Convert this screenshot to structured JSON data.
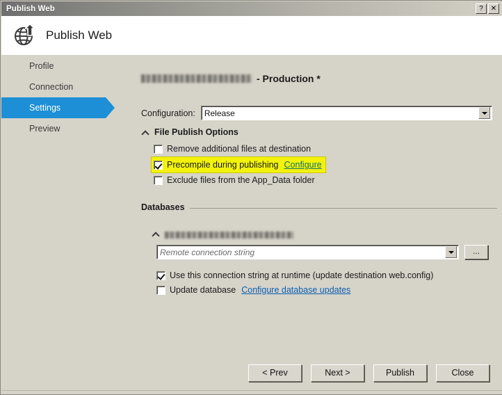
{
  "window": {
    "title": "Publish Web",
    "help_button": "?",
    "close_button": "✕"
  },
  "header": {
    "icon": "globe-publish-icon",
    "title": "Publish Web"
  },
  "sidebar": {
    "items": [
      {
        "label": "Profile",
        "selected": false
      },
      {
        "label": "Connection",
        "selected": false
      },
      {
        "label": "Settings",
        "selected": true
      },
      {
        "label": "Preview",
        "selected": false
      }
    ]
  },
  "main": {
    "profile_title_redacted": "",
    "profile_title_suffix": "- Production *",
    "configuration": {
      "label": "Configuration:",
      "value": "Release"
    },
    "file_publish_options": {
      "section_label": "File Publish Options",
      "expanded": true,
      "options": [
        {
          "label": "Remove additional files at destination",
          "checked": false,
          "highlighted": false,
          "link": null
        },
        {
          "label": "Precompile during publishing",
          "checked": true,
          "highlighted": true,
          "link": "Configure"
        },
        {
          "label": "Exclude files from the App_Data folder",
          "checked": false,
          "highlighted": false,
          "link": null
        }
      ]
    },
    "databases": {
      "section_label": "Databases",
      "entry_name_redacted": "",
      "entry_expanded": true,
      "connection_string_placeholder": "Remote connection string",
      "connection_string_value": "",
      "browse_button": "...",
      "options": [
        {
          "label": "Use this connection string at runtime (update destination web.config)",
          "checked": true,
          "link": null
        },
        {
          "label": "Update database",
          "checked": false,
          "link": "Configure database updates"
        }
      ]
    }
  },
  "footer": {
    "buttons": [
      {
        "label": "< Prev"
      },
      {
        "label": "Next >"
      },
      {
        "label": "Publish"
      },
      {
        "label": "Close"
      }
    ]
  },
  "colors": {
    "accent_selected": "#1c8fd6",
    "dialog_background": "#d6d3c9",
    "highlight_yellow": "#f2f20c",
    "link_blue": "#0a5fb0",
    "link_on_highlight": "#10726b"
  }
}
